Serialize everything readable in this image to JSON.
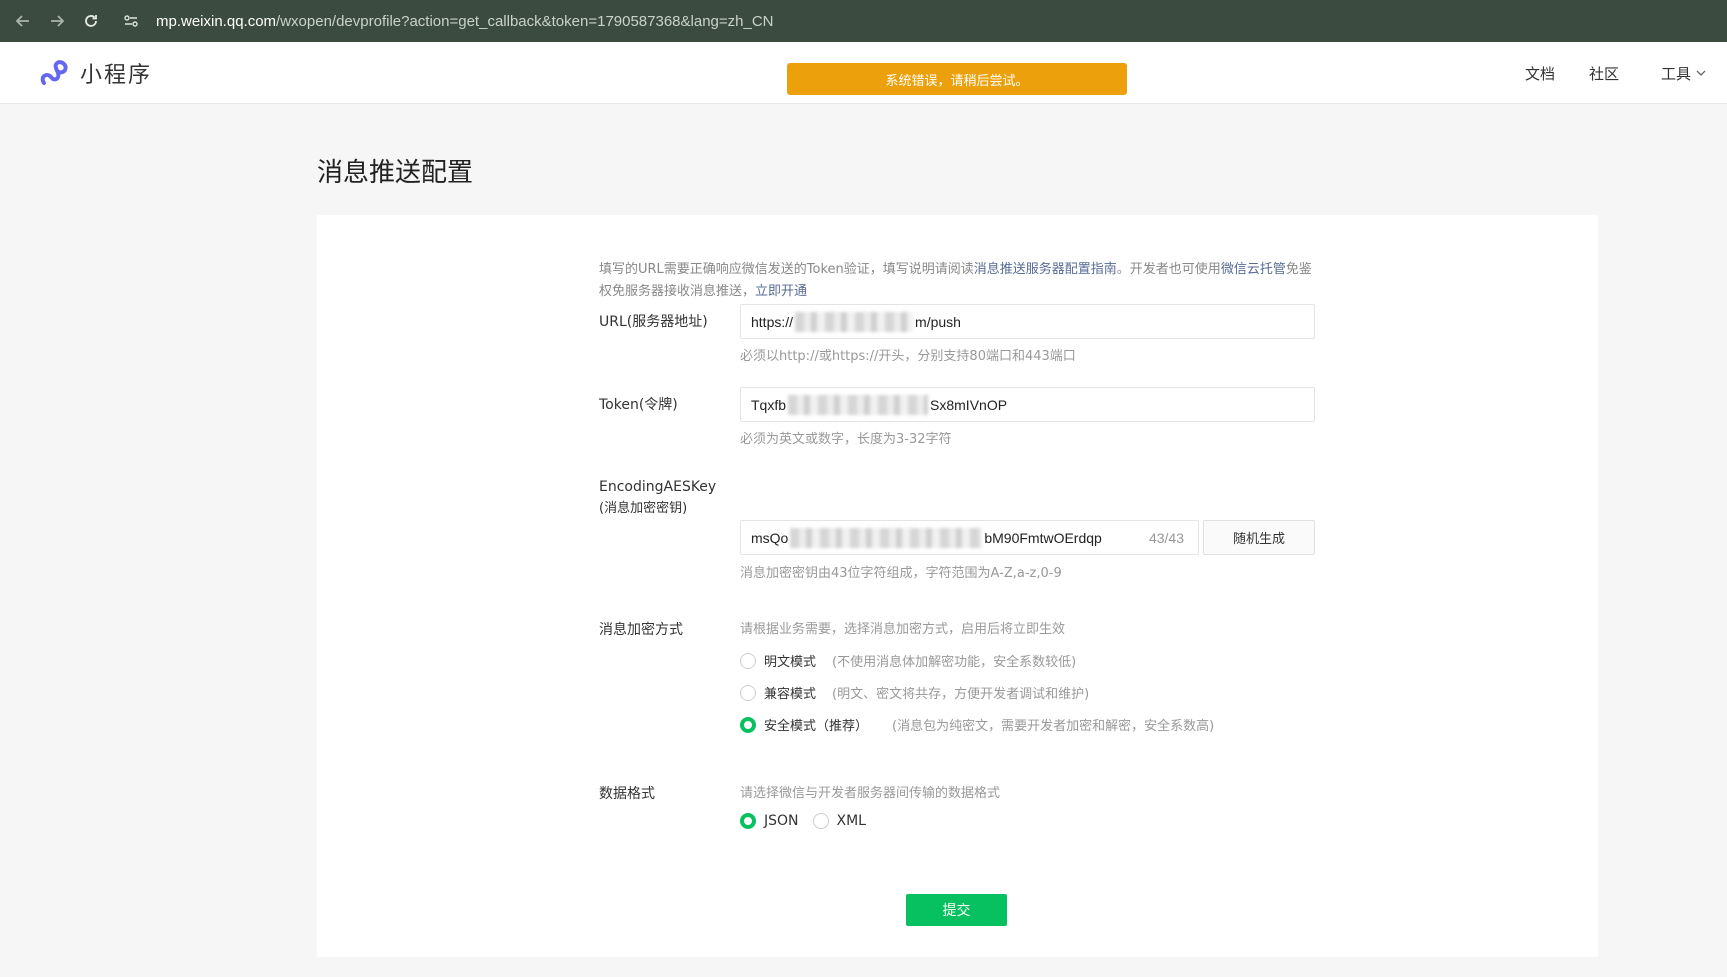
{
  "browser": {
    "url_host": "mp.weixin.qq.com",
    "url_path": "/wxopen/devprofile?action=get_callback&token=1790587368&lang=zh_CN"
  },
  "header": {
    "logo_text": "小程序",
    "toast": "系统错误，请稍后尝试。",
    "nav": [
      "文档",
      "社区",
      "工具"
    ]
  },
  "page": {
    "title": "消息推送配置",
    "intro": {
      "part1": "填写的URL需要正确响应微信发送的Token验证，填写说明请阅读",
      "link1": "消息推送服务器配置指南",
      "part2": "。开发者也可使用",
      "link2": "微信云托管",
      "part3": "免鉴权免服务器接收消息推送，",
      "link3": "立即开通"
    },
    "url_field": {
      "label": "URL(服务器地址)",
      "value_prefix": "https://",
      "value_suffix": "m/push",
      "hint": "必须以http://或https://开头，分别支持80端口和443端口"
    },
    "token_field": {
      "label": "Token(令牌)",
      "value_prefix": "Tqxfb",
      "value_suffix": "Sx8mIVnOP",
      "hint": "必须为英文或数字，长度为3-32字符"
    },
    "aes_field": {
      "label_line1": "EncodingAESKey",
      "label_line2": "(消息加密密钥)",
      "value_prefix": "msQo",
      "value_suffix": "bM90FmtwOErdqp",
      "counter": "43/43",
      "generate_button": "随机生成",
      "hint": "消息加密密钥由43位字符组成，字符范围为A-Z,a-z,0-9"
    },
    "encryption": {
      "label": "消息加密方式",
      "hint": "请根据业务需要，选择消息加密方式，启用后将立即生效",
      "options": [
        {
          "label": "明文模式",
          "desc": "(不使用消息体加解密功能，安全系数较低)",
          "selected": false
        },
        {
          "label": "兼容模式",
          "desc": "(明文、密文将共存，方便开发者调试和维护)",
          "selected": false
        },
        {
          "label": "安全模式（推荐）",
          "desc": "(消息包为纯密文，需要开发者加密和解密，安全系数高)",
          "selected": true
        }
      ]
    },
    "data_format": {
      "label": "数据格式",
      "hint": "请选择微信与开发者服务器间传输的数据格式",
      "options": [
        {
          "label": "JSON",
          "selected": true
        },
        {
          "label": "XML",
          "selected": false
        }
      ]
    },
    "submit_label": "提交"
  },
  "colors": {
    "accent_green": "#07c160",
    "toast_orange": "#eca00b",
    "link_blue": "#576b95",
    "browser_bar": "#3b4b3f"
  }
}
